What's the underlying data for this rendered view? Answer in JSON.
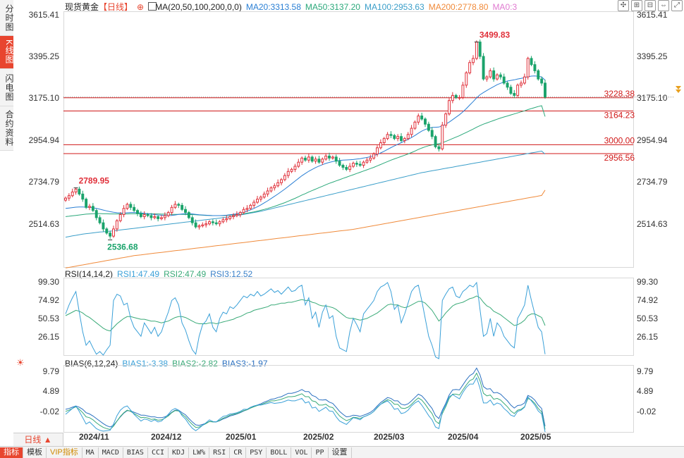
{
  "sidebar": {
    "tabs": [
      {
        "label": "分时图",
        "active": false
      },
      {
        "label": "K线图",
        "active": true
      },
      {
        "label": "闪电图",
        "active": false
      },
      {
        "label": "合约资料",
        "active": false
      }
    ]
  },
  "header": {
    "symbol": "现货黄金",
    "period": "【日线】",
    "ma_label": "MA(20,50,100,200,0,0)",
    "ma20": "MA20:3313.58",
    "ma50": "MA50:3137.20",
    "ma100": "MA100:2953.63",
    "ma200": "MA200:2778.80",
    "ma0": "MA0:3"
  },
  "colors": {
    "up": "#e0303a",
    "down": "#1aa36b",
    "ma20": "#2a7fd4",
    "ma50": "#2aa87a",
    "ma100": "#3a9ec9",
    "ma200": "#f08a3a",
    "hline": "#d01818",
    "rsi1": "#3aa0d8",
    "rsi2": "#3aaa78",
    "bias1": "#3aa0d8",
    "bias2": "#3aaa78",
    "bias3": "#2a70c0"
  },
  "rsi": {
    "title": "RSI(14,14,2)",
    "rsi1": "RSI1:47.49",
    "rsi2": "RSI2:47.49",
    "rsi3": "RSI3:12.52",
    "ticks": [
      "99.30",
      "74.92",
      "50.53",
      "26.15"
    ]
  },
  "bias": {
    "title": "BIAS(6,12,24)",
    "bias1": "BIAS1:-3.38",
    "bias2": "BIAS2:-2.82",
    "bias3": "BIAS3:-1.97",
    "ticks": [
      "9.79",
      "4.89",
      "-0.02"
    ]
  },
  "bottom": {
    "period_button": "日线 ▲",
    "items": [
      "指标",
      "模板",
      "VIP指标",
      "MA",
      "MACD",
      "BIAS",
      "CCI",
      "KDJ",
      "LW%",
      "RSI",
      "CR",
      "PSY",
      "BOLL",
      "VOL",
      "PP",
      "设置"
    ]
  },
  "chart_data": {
    "type": "candlestick",
    "price_ticks": [
      "3615.41",
      "3395.25",
      "3175.10",
      "2954.94",
      "2734.79",
      "2514.63"
    ],
    "price_range": [
      2404.55,
      3649.55
    ],
    "x_ticks": [
      "2024/11",
      "2024/12",
      "2025/01",
      "2025/02",
      "2025/03",
      "2025/04",
      "2025/05"
    ],
    "hlines": [
      {
        "value": 3228.38,
        "label": "3228.38"
      },
      {
        "value": 3164.23,
        "label": "3164.23"
      },
      {
        "value": 3000.0,
        "label": "3000.00"
      },
      {
        "value": 2956.56,
        "label": "2956.56"
      }
    ],
    "annotations": [
      {
        "text": "3499.83",
        "value": 3499.83
      },
      {
        "text": "2789.95",
        "value": 2789.95
      },
      {
        "text": "2536.68",
        "value": 2536.68
      }
    ],
    "closes": [
      2740,
      2752,
      2770,
      2784,
      2760,
      2735,
      2695,
      2700,
      2680,
      2645,
      2620,
      2590,
      2570,
      2555,
      2590,
      2630,
      2660,
      2690,
      2710,
      2695,
      2680,
      2665,
      2650,
      2660,
      2655,
      2645,
      2650,
      2640,
      2645,
      2655,
      2670,
      2695,
      2710,
      2705,
      2685,
      2670,
      2645,
      2620,
      2600,
      2605,
      2610,
      2615,
      2625,
      2620,
      2615,
      2625,
      2635,
      2640,
      2650,
      2655,
      2660,
      2670,
      2685,
      2690,
      2705,
      2720,
      2735,
      2745,
      2760,
      2775,
      2790,
      2800,
      2815,
      2830,
      2850,
      2870,
      2880,
      2895,
      2915,
      2935,
      2925,
      2940,
      2920,
      2930,
      2915,
      2930,
      2945,
      2935,
      2940,
      2920,
      2900,
      2890,
      2880,
      2895,
      2910,
      2905,
      2900,
      2915,
      2925,
      2935,
      2955,
      2985,
      3010,
      3030,
      3050,
      3045,
      3030,
      3040,
      3020,
      3030,
      3050,
      3080,
      3110,
      3140,
      3125,
      3100,
      3070,
      3040,
      2990,
      2980,
      3095,
      3150,
      3215,
      3240,
      3230,
      3230,
      3290,
      3350,
      3400,
      3420,
      3500,
      3430,
      3320,
      3330,
      3360,
      3320,
      3340,
      3330,
      3300,
      3280,
      3250,
      3240,
      3290,
      3300,
      3330,
      3420,
      3390,
      3360,
      3320,
      3300,
      3232
    ],
    "ma20": [
      2690,
      2692,
      2694,
      2696,
      2697,
      2697,
      2696,
      2695,
      2693,
      2690,
      2686,
      2682,
      2678,
      2674,
      2671,
      2669,
      2668,
      2668,
      2669,
      2670,
      2670,
      2669,
      2668,
      2666,
      2664,
      2662,
      2660,
      2658,
      2657,
      2656,
      2655,
      2656,
      2658,
      2661,
      2663,
      2664,
      2664,
      2663,
      2661,
      2659,
      2658,
      2657,
      2656,
      2655,
      2655,
      2655,
      2656,
      2657,
      2659,
      2661,
      2664,
      2668,
      2672,
      2677,
      2683,
      2690,
      2698,
      2707,
      2717,
      2727,
      2738,
      2749,
      2760,
      2772,
      2784,
      2797,
      2810,
      2823,
      2836,
      2849,
      2860,
      2871,
      2880,
      2889,
      2896,
      2903,
      2909,
      2914,
      2918,
      2921,
      2923,
      2925,
      2926,
      2927,
      2928,
      2930,
      2932,
      2935,
      2938,
      2942,
      2947,
      2953,
      2960,
      2968,
      2977,
      2986,
      2994,
      3002,
      3010,
      3018,
      3026,
      3035,
      3045,
      3056,
      3066,
      3074,
      3080,
      3084,
      3085,
      3086,
      3092,
      3100,
      3110,
      3122,
      3134,
      3146,
      3160,
      3176,
      3193,
      3210,
      3228,
      3243,
      3254,
      3264,
      3274,
      3283,
      3292,
      3299,
      3305,
      3310,
      3313,
      3316,
      3320,
      3323,
      3326,
      3331,
      3334,
      3335,
      3333,
      3330,
      3314
    ],
    "ma50": [
      2650,
      2652,
      2654,
      2656,
      2658,
      2660,
      2662,
      2663,
      2664,
      2665,
      2665,
      2664,
      2664,
      2663,
      2663,
      2663,
      2663,
      2663,
      2663,
      2664,
      2664,
      2664,
      2664,
      2664,
      2664,
      2664,
      2663,
      2663,
      2662,
      2662,
      2661,
      2661,
      2661,
      2661,
      2661,
      2661,
      2660,
      2660,
      2659,
      2658,
      2657,
      2656,
      2656,
      2655,
      2655,
      2655,
      2655,
      2656,
      2657,
      2658,
      2660,
      2662,
      2664,
      2667,
      2670,
      2673,
      2677,
      2681,
      2685,
      2690,
      2695,
      2700,
      2706,
      2712,
      2718,
      2725,
      2732,
      2739,
      2747,
      2755,
      2762,
      2770,
      2777,
      2784,
      2791,
      2798,
      2805,
      2812,
      2818,
      2824,
      2830,
      2836,
      2842,
      2848,
      2854,
      2860,
      2866,
      2872,
      2878,
      2884,
      2890,
      2897,
      2904,
      2911,
      2918,
      2925,
      2931,
      2937,
      2943,
      2949,
      2955,
      2962,
      2969,
      2977,
      2984,
      2990,
      2995,
      2999,
      3002,
      3005,
      3010,
      3016,
      3023,
      3030,
      3037,
      3044,
      3052,
      3060,
      3068,
      3076,
      3085,
      3093,
      3100,
      3106,
      3112,
      3118,
      3124,
      3130,
      3135,
      3140,
      3145,
      3150,
      3155,
      3160,
      3165,
      3171,
      3176,
      3181,
      3186,
      3190,
      3137
    ],
    "ma100": [
      2550,
      2553,
      2556,
      2559,
      2562,
      2565,
      2567,
      2569,
      2571,
      2573,
      2575,
      2576,
      2578,
      2579,
      2581,
      2583,
      2585,
      2587,
      2589,
      2591,
      2593,
      2595,
      2597,
      2599,
      2601,
      2603,
      2605,
      2607,
      2609,
      2611,
      2613,
      2615,
      2617,
      2619,
      2621,
      2623,
      2625,
      2627,
      2629,
      2631,
      2633,
      2635,
      2637,
      2639,
      2641,
      2643,
      2645,
      2647,
      2649,
      2652,
      2655,
      2658,
      2661,
      2664,
      2667,
      2670,
      2673,
      2676,
      2680,
      2684,
      2688,
      2692,
      2696,
      2700,
      2704,
      2708,
      2712,
      2716,
      2720,
      2724,
      2728,
      2732,
      2736,
      2740,
      2744,
      2748,
      2752,
      2756,
      2760,
      2764,
      2768,
      2772,
      2776,
      2780,
      2784,
      2788,
      2792,
      2796,
      2800,
      2804,
      2808,
      2812,
      2816,
      2820,
      2824,
      2828,
      2832,
      2836,
      2840,
      2844,
      2848,
      2852,
      2856,
      2860,
      2864,
      2867,
      2870,
      2873,
      2876,
      2879,
      2882,
      2885,
      2888,
      2891,
      2894,
      2897,
      2900,
      2903,
      2906,
      2909,
      2912,
      2915,
      2918,
      2921,
      2924,
      2927,
      2930,
      2933,
      2936,
      2939,
      2942,
      2945,
      2948,
      2951,
      2954,
      2957,
      2960,
      2963,
      2966,
      2969,
      2954
    ],
    "ma200": [
      2400,
      2403,
      2406,
      2409,
      2412,
      2415,
      2418,
      2421,
      2424,
      2427,
      2430,
      2433,
      2436,
      2439,
      2442,
      2445,
      2448,
      2451,
      2454,
      2457,
      2460,
      2462,
      2464,
      2466,
      2468,
      2470,
      2472,
      2474,
      2476,
      2478,
      2480,
      2482,
      2484,
      2486,
      2488,
      2490,
      2492,
      2494,
      2496,
      2498,
      2500,
      2502,
      2504,
      2506,
      2508,
      2510,
      2512,
      2514,
      2516,
      2518,
      2520,
      2522,
      2524,
      2526,
      2528,
      2530,
      2532,
      2534,
      2536,
      2538,
      2540,
      2542,
      2544,
      2546,
      2548,
      2550,
      2552,
      2554,
      2556,
      2558,
      2560,
      2562,
      2564,
      2566,
      2568,
      2570,
      2572,
      2574,
      2576,
      2578,
      2580,
      2582,
      2584,
      2586,
      2588,
      2591,
      2594,
      2597,
      2600,
      2603,
      2606,
      2609,
      2612,
      2615,
      2618,
      2621,
      2624,
      2627,
      2630,
      2633,
      2636,
      2639,
      2642,
      2645,
      2648,
      2651,
      2654,
      2657,
      2660,
      2663,
      2666,
      2669,
      2672,
      2675,
      2678,
      2681,
      2684,
      2687,
      2690,
      2693,
      2696,
      2699,
      2702,
      2705,
      2708,
      2711,
      2714,
      2717,
      2720,
      2723,
      2726,
      2729,
      2732,
      2735,
      2738,
      2741,
      2744,
      2747,
      2750,
      2753,
      2779
    ],
    "rsi_range": [
      14.0,
      111.5
    ],
    "rsi1_values": [
      60,
      70,
      78,
      85,
      62,
      40,
      25,
      30,
      22,
      15,
      18,
      14,
      20,
      25,
      75,
      82,
      80,
      70,
      72,
      55,
      45,
      40,
      35,
      50,
      44,
      38,
      45,
      35,
      40,
      52,
      62,
      75,
      78,
      70,
      50,
      42,
      30,
      20,
      15,
      35,
      48,
      52,
      60,
      45,
      40,
      55,
      62,
      60,
      68,
      66,
      70,
      75,
      80,
      78,
      82,
      80,
      85,
      80,
      82,
      85,
      88,
      84,
      86,
      82,
      86,
      90,
      85,
      86,
      90,
      92,
      70,
      78,
      55,
      62,
      45,
      62,
      70,
      55,
      58,
      35,
      22,
      20,
      18,
      40,
      55,
      48,
      40,
      60,
      65,
      70,
      75,
      85,
      90,
      92,
      95,
      85,
      65,
      70,
      50,
      60,
      72,
      85,
      90,
      92,
      75,
      55,
      35,
      25,
      12,
      10,
      75,
      82,
      88,
      90,
      80,
      78,
      85,
      88,
      92,
      90,
      95,
      65,
      35,
      38,
      55,
      35,
      50,
      45,
      35,
      30,
      25,
      22,
      55,
      62,
      70,
      92,
      75,
      60,
      45,
      40,
      15
    ],
    "rsi2_values": [
      58,
      60,
      62,
      64,
      63,
      61,
      58,
      56,
      53,
      50,
      47,
      44,
      42,
      41,
      45,
      49,
      52,
      55,
      57,
      57,
      56,
      55,
      54,
      54,
      53,
      52,
      52,
      51,
      50,
      51,
      52,
      54,
      56,
      57,
      57,
      56,
      54,
      52,
      50,
      49,
      49,
      49,
      50,
      50,
      49,
      50,
      51,
      52,
      53,
      54,
      56,
      57,
      59,
      61,
      62,
      64,
      65,
      66,
      67,
      68,
      70,
      70,
      71,
      72,
      72,
      73,
      73,
      74,
      75,
      76,
      75,
      75,
      73,
      72,
      70,
      69,
      69,
      68,
      67,
      65,
      62,
      59,
      56,
      55,
      55,
      54,
      53,
      54,
      55,
      57,
      59,
      61,
      64,
      67,
      70,
      71,
      70,
      70,
      68,
      67,
      68,
      70,
      72,
      74,
      74,
      72,
      68,
      64,
      58,
      52,
      56,
      61,
      65,
      69,
      71,
      72,
      73,
      75,
      77,
      78,
      80,
      78,
      73,
      69,
      67,
      63,
      61,
      59,
      56,
      53,
      50,
      47,
      48,
      50,
      53,
      58,
      60,
      60,
      58,
      56,
      47
    ],
    "bias_range": [
      -3.38,
      12.2
    ],
    "bias1_values": [
      0.8,
      1.5,
      2.2,
      2.8,
      1.5,
      0.0,
      -1.5,
      -1.0,
      -1.8,
      -2.6,
      -3.0,
      -3.2,
      -3.1,
      -3.0,
      -1.5,
      0.5,
      1.8,
      2.5,
      2.8,
      1.8,
      0.8,
      0.0,
      -0.8,
      -0.3,
      -0.5,
      -0.9,
      -0.5,
      -1.0,
      -0.8,
      0.0,
      0.8,
      1.8,
      2.2,
      1.8,
      0.5,
      -0.3,
      -1.5,
      -2.5,
      -3.1,
      -2.5,
      -1.8,
      -1.2,
      -0.5,
      -0.9,
      -1.0,
      -0.3,
      0.3,
      0.5,
      0.9,
      1.0,
      1.2,
      1.5,
      2.0,
      2.0,
      2.5,
      2.8,
      3.0,
      3.0,
      3.2,
      3.4,
      3.6,
      3.4,
      3.5,
      3.6,
      3.9,
      4.2,
      4.0,
      4.0,
      4.3,
      4.6,
      3.5,
      3.8,
      2.3,
      2.5,
      1.5,
      2.0,
      2.5,
      1.6,
      1.5,
      0.2,
      -0.8,
      -1.2,
      -1.6,
      -0.8,
      0.0,
      -0.2,
      -0.5,
      0.2,
      0.5,
      0.9,
      1.5,
      2.5,
      3.2,
      3.6,
      4.0,
      3.2,
      2.0,
      2.2,
      1.0,
      1.2,
      1.8,
      2.8,
      3.5,
      4.0,
      3.0,
      1.8,
      0.5,
      -0.5,
      -2.2,
      -2.6,
      1.5,
      3.0,
      5.0,
      5.5,
      5.0,
      4.5,
      6.0,
      7.2,
      8.0,
      8.0,
      9.5,
      7.0,
      3.5,
      3.5,
      4.2,
      3.0,
      3.5,
      3.2,
      2.2,
      1.5,
      0.6,
      0.3,
      1.5,
      1.8,
      2.5,
      5.0,
      4.0,
      3.0,
      1.6,
      0.9,
      -3.4
    ],
    "bias2_values": [
      1.5,
      1.8,
      2.2,
      2.6,
      2.0,
      1.2,
      0.2,
      0.0,
      -0.5,
      -1.2,
      -1.8,
      -2.3,
      -2.6,
      -2.8,
      -2.0,
      -0.8,
      0.3,
      1.2,
      1.8,
      1.5,
      1.0,
      0.5,
      0.0,
      0.1,
      -0.1,
      -0.4,
      -0.3,
      -0.6,
      -0.5,
      -0.1,
      0.4,
      1.2,
      1.7,
      1.6,
      0.8,
      0.2,
      -0.8,
      -1.6,
      -2.3,
      -2.2,
      -1.8,
      -1.4,
      -0.9,
      -1.0,
      -1.0,
      -0.6,
      -0.1,
      0.2,
      0.6,
      0.8,
      1.0,
      1.3,
      1.7,
      1.9,
      2.3,
      2.6,
      2.9,
      3.1,
      3.4,
      3.7,
      4.0,
      4.0,
      4.2,
      4.4,
      4.7,
      5.0,
      5.0,
      5.1,
      5.4,
      5.7,
      5.0,
      5.0,
      4.0,
      3.8,
      3.0,
      3.0,
      3.2,
      2.6,
      2.4,
      1.4,
      0.4,
      -0.2,
      -0.7,
      -0.4,
      0.1,
      0.0,
      -0.2,
      0.2,
      0.5,
      0.9,
      1.5,
      2.4,
      3.2,
      3.8,
      4.3,
      4.0,
      3.2,
      3.2,
      2.3,
      2.2,
      2.5,
      3.2,
      4.0,
      4.7,
      4.2,
      3.2,
      2.0,
      1.0,
      -0.8,
      -1.4,
      1.0,
      2.6,
      4.6,
      5.6,
      5.6,
      5.4,
      6.6,
      7.8,
      8.8,
      9.2,
      10.6,
      8.8,
      5.8,
      5.2,
      5.4,
      4.4,
      4.6,
      4.2,
      3.4,
      2.6,
      1.6,
      1.0,
      1.8,
      2.0,
      2.6,
      4.6,
      4.2,
      3.4,
      2.2,
      1.4,
      -2.8
    ],
    "bias3_values": [
      2.0,
      2.2,
      2.5,
      2.8,
      2.5,
      2.0,
      1.2,
      0.9,
      0.4,
      -0.2,
      -0.8,
      -1.4,
      -1.9,
      -2.2,
      -1.8,
      -0.8,
      0.2,
      1.1,
      1.7,
      1.6,
      1.3,
      1.0,
      0.6,
      0.6,
      0.4,
      0.2,
      0.2,
      0.0,
      0.0,
      0.2,
      0.6,
      1.3,
      1.8,
      1.8,
      1.2,
      0.7,
      -0.2,
      -1.0,
      -1.7,
      -1.8,
      -1.6,
      -1.3,
      -0.9,
      -1.0,
      -1.0,
      -0.7,
      -0.3,
      0.0,
      0.4,
      0.6,
      0.9,
      1.2,
      1.6,
      1.9,
      2.3,
      2.7,
      3.0,
      3.3,
      3.7,
      4.0,
      4.4,
      4.5,
      4.8,
      5.0,
      5.4,
      5.8,
      5.8,
      6.0,
      6.3,
      6.7,
      6.2,
      6.2,
      5.3,
      5.0,
      4.3,
      4.2,
      4.3,
      3.7,
      3.4,
      2.5,
      1.5,
      0.8,
      0.2,
      0.3,
      0.6,
      0.5,
      0.3,
      0.6,
      0.9,
      1.3,
      1.9,
      2.8,
      3.6,
      4.2,
      4.8,
      4.6,
      4.0,
      4.0,
      3.2,
      3.0,
      3.3,
      4.0,
      4.8,
      5.6,
      5.2,
      4.3,
      3.2,
      2.2,
      0.5,
      -0.2,
      1.8,
      3.4,
      5.4,
      6.6,
      6.7,
      6.6,
      7.8,
      9.0,
      10.0,
      10.5,
      11.8,
      10.2,
      7.4,
      6.8,
      6.9,
      5.9,
      6.0,
      5.6,
      4.8,
      4.0,
      3.0,
      2.3,
      2.9,
      3.0,
      3.5,
      5.3,
      4.9,
      4.2,
      3.0,
      2.2,
      -2.0
    ]
  }
}
